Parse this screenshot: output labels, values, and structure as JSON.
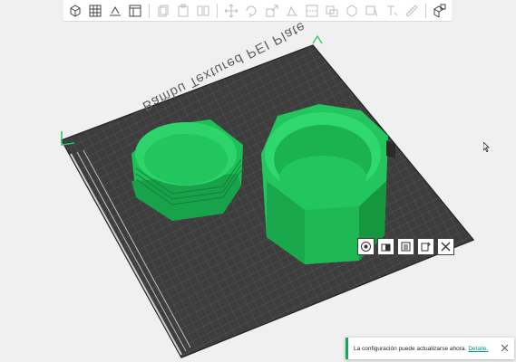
{
  "toolbar": {
    "groups": [
      [
        "add-object-icon",
        "arrange-grid-icon",
        "orient-icon",
        "layout-panel-icon"
      ],
      [
        "copy-icon",
        "paste-icon",
        "split-icon"
      ],
      [
        "move-icon",
        "rotate-icon",
        "scale-icon",
        "lay-on-face-icon",
        "cut-icon",
        "support-paint-icon",
        "seam-paint-icon",
        "color-paint-icon",
        "text-tool-icon",
        "measure-icon"
      ],
      [
        "assembly-icon"
      ]
    ]
  },
  "plate": {
    "label": "Bambu Textured PEI Plate",
    "tools": [
      "◉",
      "▣",
      "▤",
      "▦",
      "✕"
    ]
  },
  "notification": {
    "message": "La configuración puede actualizarse ahora.",
    "link": "Detalle."
  },
  "colors": {
    "plate": "#3d3d3d",
    "plate_grid": "#5a5a5a",
    "object_green": "#22c55e",
    "accent": "#1ea35a"
  }
}
